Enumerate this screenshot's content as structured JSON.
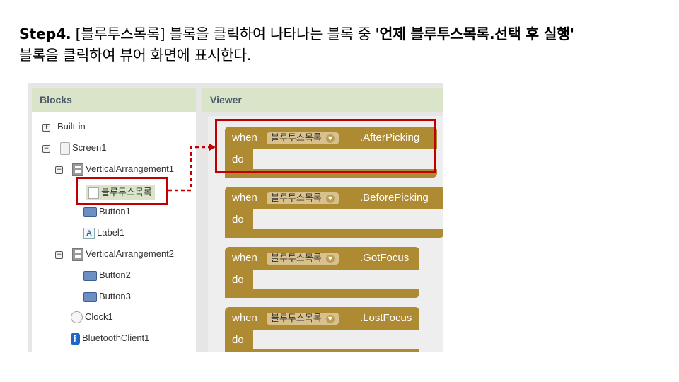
{
  "caption": {
    "step": "Step4.",
    "part1": " [블루투스목록] 블록을 클릭하여 나타나는 블록 중 ",
    "quoted": "'언제 블루투스목록.선택 후 실행'",
    "line2": "블록을 클릭하여 뷰어 화면에 표시한다."
  },
  "blocks_panel": {
    "title": "Blocks",
    "tree": {
      "builtin": "Built-in",
      "screen": "Screen1",
      "varr1": "VerticalArrangement1",
      "listpicker": "블루투스목록",
      "button1": "Button1",
      "label1": "Label1",
      "varr2": "VerticalArrangement2",
      "button2": "Button2",
      "button3": "Button3",
      "clock": "Clock1",
      "bluetooth": "BluetoothClient1"
    }
  },
  "viewer": {
    "title": "Viewer",
    "blocks": [
      {
        "when": "when",
        "component": "블루투스목록",
        "event": ".AfterPicking",
        "do": "do"
      },
      {
        "when": "when",
        "component": "블루투스목록",
        "event": ".BeforePicking",
        "do": "do"
      },
      {
        "when": "when",
        "component": "블루투스목록",
        "event": ".GotFocus",
        "do": "do"
      },
      {
        "when": "when",
        "component": "블루투스목록",
        "event": ".LostFocus",
        "do": "do"
      }
    ]
  },
  "colors": {
    "highlight": "#c00000",
    "event_block": "#ae8a33",
    "panel_header": "#d9e4c8"
  }
}
